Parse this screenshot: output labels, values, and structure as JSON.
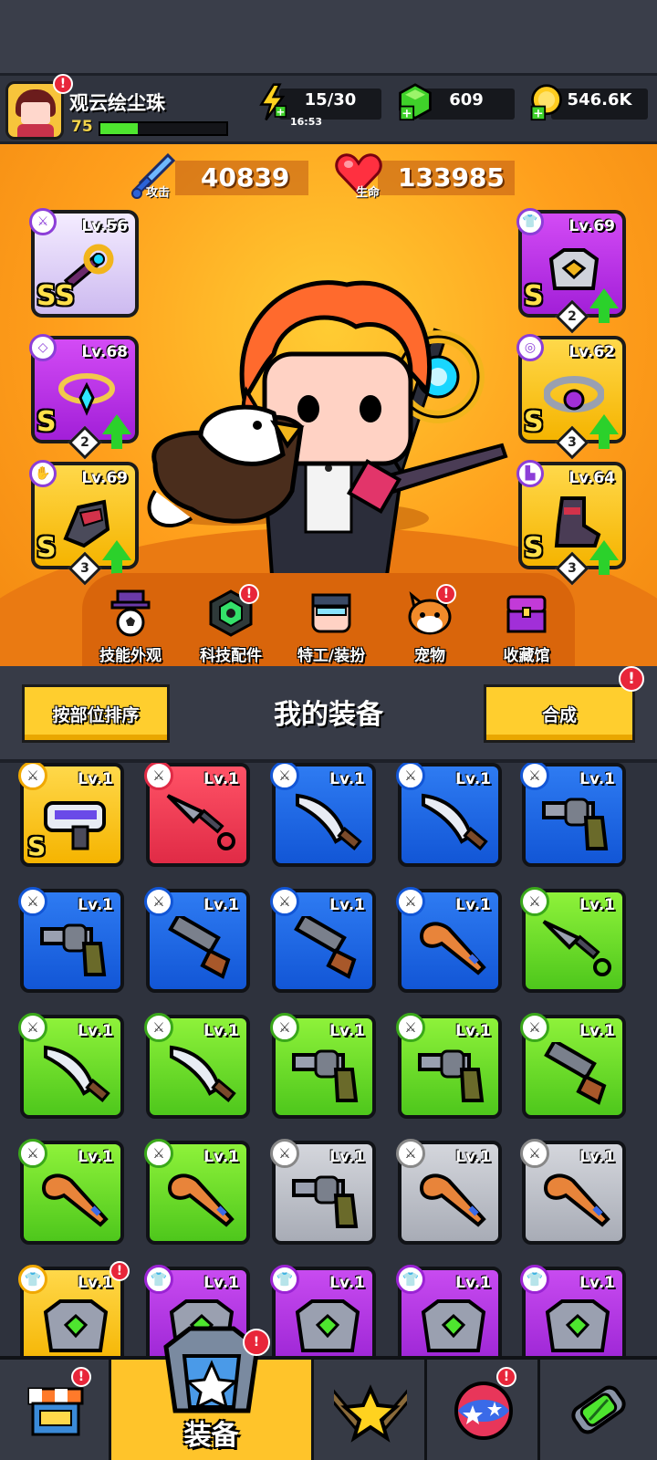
{
  "player": {
    "name": "观云绘尘珠",
    "level": "75",
    "xp_progress": 0.3
  },
  "resources": {
    "energy": "15/30",
    "energy_timer": "16:53",
    "gems": "609",
    "coins": "546.6K"
  },
  "stats": {
    "attack_label": "攻击",
    "attack_value": "40839",
    "hp_label": "生命",
    "hp_value": "133985"
  },
  "equipped": [
    {
      "slot": "weapon",
      "level": "Lv.56",
      "grade": "SS",
      "stars": "",
      "upgradable": false,
      "color": "lavender"
    },
    {
      "slot": "necklace",
      "level": "Lv.68",
      "grade": "S",
      "stars": "2",
      "upgradable": true,
      "color": "purple"
    },
    {
      "slot": "gloves",
      "level": "Lv.69",
      "grade": "S",
      "stars": "3",
      "upgradable": true,
      "color": "gold"
    },
    {
      "slot": "armor",
      "level": "Lv.69",
      "grade": "S",
      "stars": "2",
      "upgradable": true,
      "color": "purple"
    },
    {
      "slot": "belt",
      "level": "Lv.62",
      "grade": "S",
      "stars": "3",
      "upgradable": true,
      "color": "gold"
    },
    {
      "slot": "boots",
      "level": "Lv.64",
      "grade": "S",
      "stars": "3",
      "upgradable": true,
      "color": "gold"
    }
  ],
  "features": [
    {
      "label": "技能外观",
      "alert": false
    },
    {
      "label": "科技配件",
      "alert": true
    },
    {
      "label": "特工/装扮",
      "alert": false
    },
    {
      "label": "宠物",
      "alert": true
    },
    {
      "label": "收藏馆",
      "alert": false
    }
  ],
  "gear_bar": {
    "sort_label": "按部位排序",
    "title": "我的装备",
    "merge_label": "合成"
  },
  "inventory": [
    {
      "color": "gold",
      "level": "Lv.1",
      "item": "blaster",
      "grade": "S"
    },
    {
      "color": "red",
      "level": "Lv.1",
      "item": "kunai",
      "grade": ""
    },
    {
      "color": "blue",
      "level": "Lv.1",
      "item": "machete",
      "grade": ""
    },
    {
      "color": "blue",
      "level": "Lv.1",
      "item": "machete",
      "grade": ""
    },
    {
      "color": "blue",
      "level": "Lv.1",
      "item": "revolver",
      "grade": ""
    },
    {
      "color": "blue",
      "level": "Lv.1",
      "item": "revolver",
      "grade": ""
    },
    {
      "color": "blue",
      "level": "Lv.1",
      "item": "shotgun",
      "grade": ""
    },
    {
      "color": "blue",
      "level": "Lv.1",
      "item": "shotgun",
      "grade": ""
    },
    {
      "color": "blue",
      "level": "Lv.1",
      "item": "bat",
      "grade": ""
    },
    {
      "color": "green",
      "level": "Lv.1",
      "item": "kunai",
      "grade": ""
    },
    {
      "color": "green",
      "level": "Lv.1",
      "item": "machete",
      "grade": ""
    },
    {
      "color": "green",
      "level": "Lv.1",
      "item": "machete",
      "grade": ""
    },
    {
      "color": "green",
      "level": "Lv.1",
      "item": "revolver",
      "grade": ""
    },
    {
      "color": "green",
      "level": "Lv.1",
      "item": "revolver",
      "grade": ""
    },
    {
      "color": "green",
      "level": "Lv.1",
      "item": "shotgun",
      "grade": ""
    },
    {
      "color": "green",
      "level": "Lv.1",
      "item": "bat",
      "grade": ""
    },
    {
      "color": "green",
      "level": "Lv.1",
      "item": "bat",
      "grade": ""
    },
    {
      "color": "gray",
      "level": "Lv.1",
      "item": "revolver",
      "grade": ""
    },
    {
      "color": "gray",
      "level": "Lv.1",
      "item": "bat",
      "grade": ""
    },
    {
      "color": "gray",
      "level": "Lv.1",
      "item": "bat",
      "grade": ""
    },
    {
      "color": "gold",
      "level": "Lv.1",
      "item": "armor",
      "grade": ""
    },
    {
      "color": "purple",
      "level": "Lv.1",
      "item": "armor",
      "grade": ""
    },
    {
      "color": "purple",
      "level": "Lv.1",
      "item": "armor",
      "grade": ""
    },
    {
      "color": "purple",
      "level": "Lv.1",
      "item": "armor",
      "grade": ""
    },
    {
      "color": "purple",
      "level": "Lv.1",
      "item": "armor",
      "grade": ""
    }
  ],
  "bottom_nav": {
    "shop_icon": "shop-icon",
    "equipment_label": "装备",
    "challenge_icon": "star-swords-icon",
    "gacha_icon": "orb-icon",
    "evolve_icon": "dna-capsule-icon"
  },
  "alert_mark": "!",
  "colors": {
    "accent_yellow": "#ffce2e",
    "stage_orange": "#ff9f1c",
    "alert_red": "#e8263a",
    "xp_green": "#4ee52f"
  }
}
